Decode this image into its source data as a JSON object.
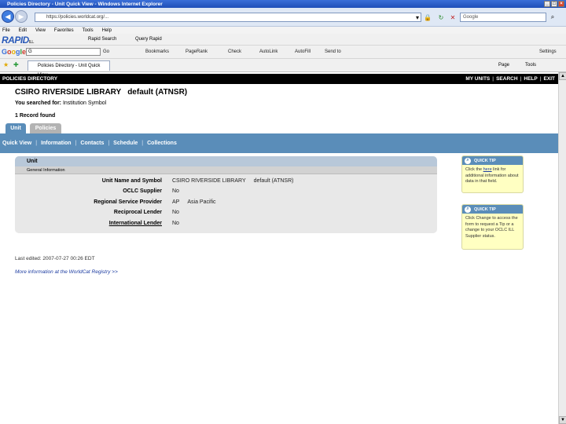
{
  "window": {
    "title": "Policies Directory - Unit Quick View - Windows Internet Explorer"
  },
  "address_bar": {
    "url": "https://policies.worldcat.org/...",
    "search_placeholder": "Google"
  },
  "menu": [
    "File",
    "Edit",
    "View",
    "Favorites",
    "Tools",
    "Help"
  ],
  "toolbar1": {
    "logo": "RAPID",
    "logo_sub": "ILL",
    "items": [
      "Rapid Search",
      "Query Rapid"
    ]
  },
  "toolbar2": {
    "logo": "Google",
    "search_value": "G",
    "items": [
      "Go",
      "Bookmarks",
      "PageRank",
      "Check",
      "AutoLink",
      "AutoFill",
      "Send to",
      "Settings"
    ]
  },
  "browser_tab": {
    "label": "Policies Directory - Unit Quick View",
    "tools": [
      "Page",
      "Tools"
    ]
  },
  "page_header": {
    "title": "POLICIES DIRECTORY",
    "links": [
      "MY UNITS",
      "SEARCH",
      "HELP",
      "EXIT"
    ]
  },
  "library": {
    "name": "CSIRO RIVERSIDE LIBRARY",
    "code": "default (ATNSR)"
  },
  "search_summary": {
    "prefix": "You searched for:",
    "term": "Institution Symbol"
  },
  "record_count": "1 Record found",
  "tabs": [
    "Unit",
    "Policies"
  ],
  "subnav": [
    "Quick View",
    "Information",
    "Contacts",
    "Schedule",
    "Collections"
  ],
  "unit_panel": {
    "header": "Unit",
    "subheader": "General Information",
    "rows": [
      {
        "label": "Unit Name and Symbol",
        "value": "CSIRO RIVERSIDE LIBRARY",
        "extra": "default (ATNSR)"
      },
      {
        "label": "OCLC Supplier",
        "value": "No",
        "extra": ""
      },
      {
        "label": "Regional Service Provider",
        "value": "AP",
        "extra": "Asia Pacific"
      },
      {
        "label": "Reciprocal Lender",
        "value": "No",
        "extra": ""
      },
      {
        "label": "International Lender",
        "value": "No",
        "extra": ""
      }
    ]
  },
  "quick_tips": [
    {
      "title": "QUICK TIP",
      "body_before": "Click the",
      "link": "here",
      "body_after": "link for additional information about data in that field."
    },
    {
      "title": "QUICK TIP",
      "body_before": "Click Change to access the form to request a Tip or a change to your OCLC ILL Supplier status.",
      "link": "",
      "body_after": ""
    }
  ],
  "last_edited": "Last edited: 2007-07-27 00:26 EDT",
  "more_info": "More information at the WorldCat Registry >>"
}
